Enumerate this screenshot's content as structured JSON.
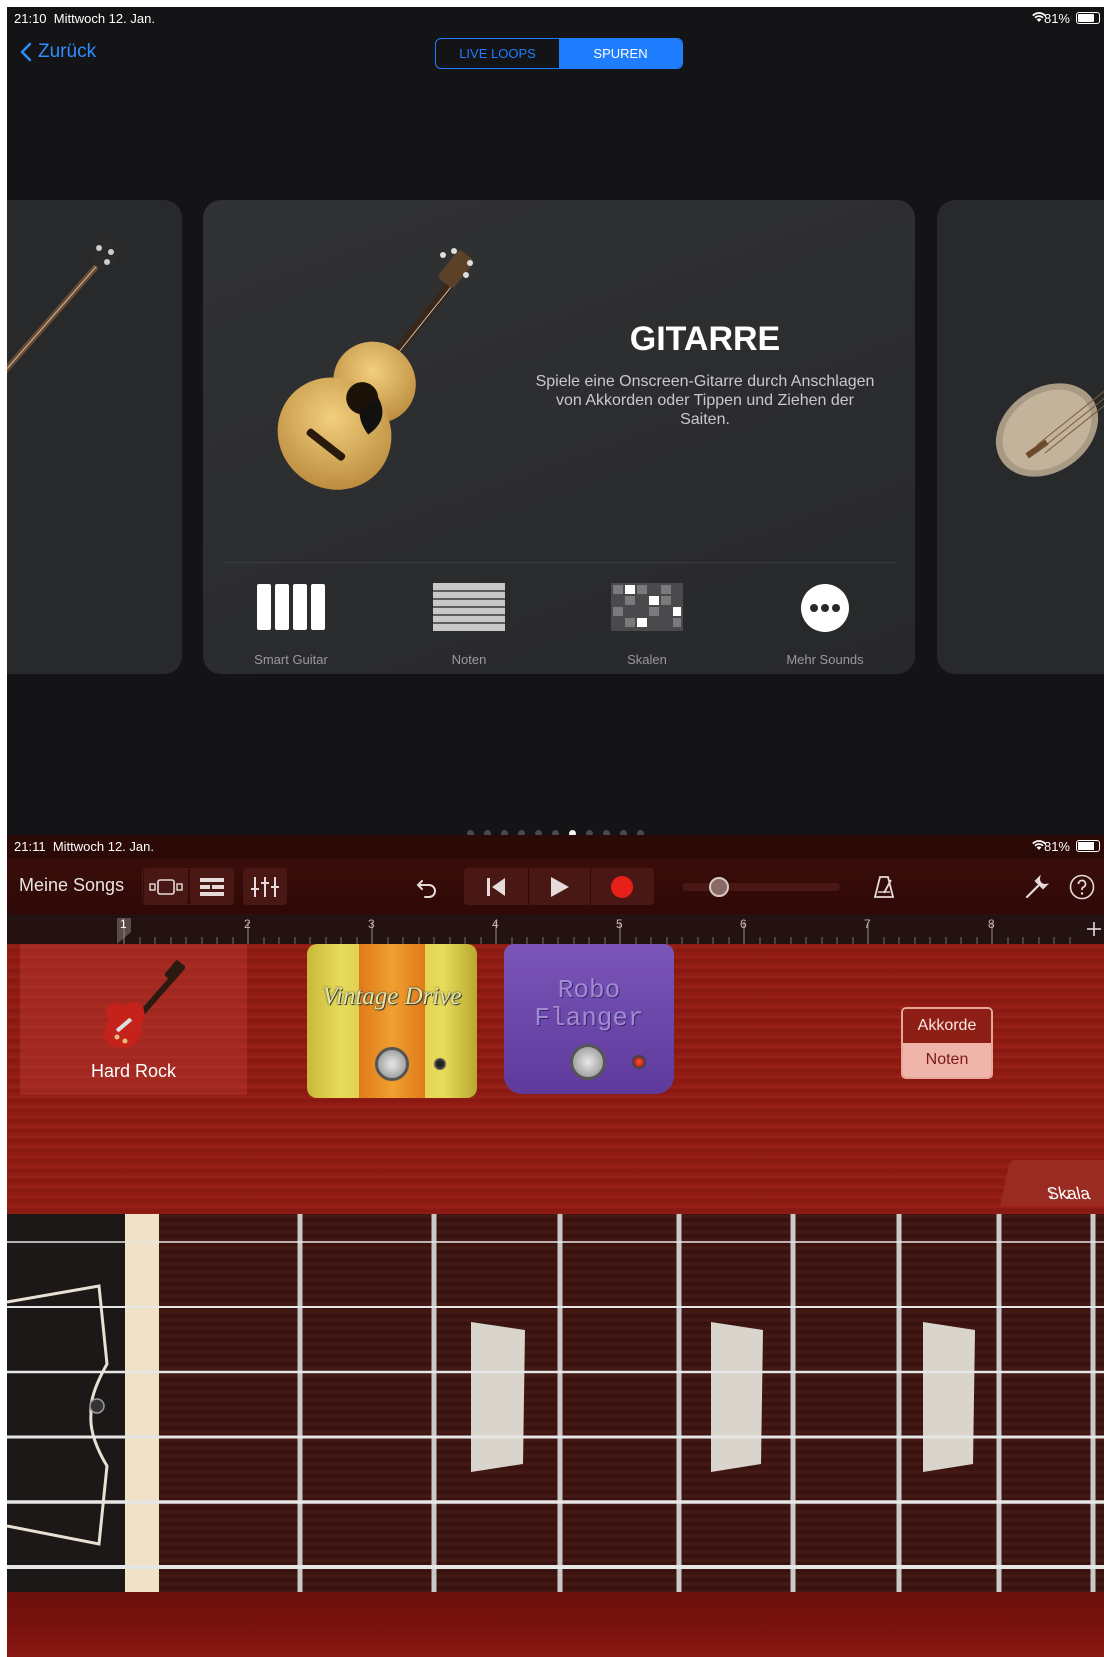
{
  "screen1": {
    "status": {
      "time": "21:10",
      "date": "Mittwoch 12. Jan.",
      "battery": "81%"
    },
    "nav": {
      "back_label": "Zurück"
    },
    "segments": [
      {
        "label": "LIVE LOOPS",
        "active": false
      },
      {
        "label": "SPUREN",
        "active": true
      }
    ],
    "card": {
      "title": "GITARRE",
      "description": "Spiele eine Onscreen-Gitarre durch Anschlagen von Akkorden oder Tippen und Ziehen der Saiten.",
      "options": [
        {
          "label": "Smart Guitar",
          "icon": "smart-guitar-icon"
        },
        {
          "label": "Noten",
          "icon": "notes-icon"
        },
        {
          "label": "Skalen",
          "icon": "scales-icon"
        },
        {
          "label": "Mehr Sounds",
          "icon": "more-icon"
        }
      ]
    },
    "page_dots": {
      "count": 11,
      "active_index": 6
    }
  },
  "screen2": {
    "status": {
      "time": "21:11",
      "date": "Mittwoch 12. Jan.",
      "battery": "81%"
    },
    "toolbar": {
      "songs_label": "Meine Songs"
    },
    "ruler": {
      "marks": [
        "1",
        "2",
        "3",
        "4",
        "5",
        "6",
        "7",
        "8"
      ]
    },
    "preset": {
      "label": "Hard Rock"
    },
    "pedals": [
      {
        "name": "Vintage Drive"
      },
      {
        "name": "Robo Flanger"
      }
    ],
    "mode_toggle": {
      "options": [
        "Akkorde",
        "Noten"
      ],
      "selected": "Noten"
    },
    "scale_button": {
      "label": "Skala"
    }
  },
  "colors": {
    "accent": "#1f7dff",
    "record": "#e8201a",
    "wood": "#8c1a12"
  }
}
